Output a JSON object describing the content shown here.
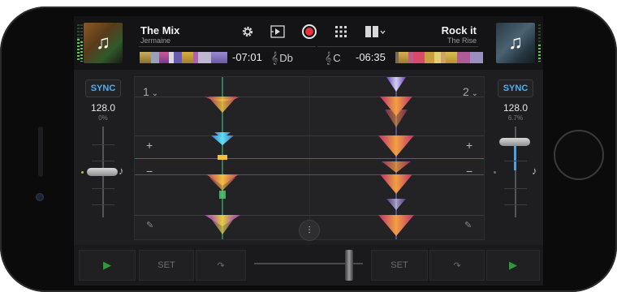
{
  "deck_left": {
    "title": "The Mix",
    "artist": "Jermaine",
    "time_remaining": "-07:01",
    "key": "Db",
    "deck_number": "1",
    "sync_label": "SYNC",
    "bpm": "128.0",
    "pitch_percent": "0%",
    "level": 0.6
  },
  "deck_right": {
    "title": "Rock it",
    "artist": "The Rise",
    "time_remaining": "-06:35",
    "key": "C",
    "deck_number": "2",
    "sync_label": "SYNC",
    "bpm": "128.0",
    "pitch_percent": "6.7%",
    "level": 0.45
  },
  "toolbar": {
    "icons": [
      "gear-icon",
      "playlist-icon",
      "record-icon",
      "grid-icon",
      "layout-icon"
    ]
  },
  "waveform": {
    "plus": "+",
    "minus": "−",
    "chevron": "⌄"
  },
  "bottom": {
    "set_label": "SET",
    "set_label_right": "SET"
  },
  "colors": {
    "sync_blue": "#4fb0f0",
    "record_red": "#e8323c",
    "playhead_red": "#d03020",
    "play_green": "#2e9a3a"
  }
}
